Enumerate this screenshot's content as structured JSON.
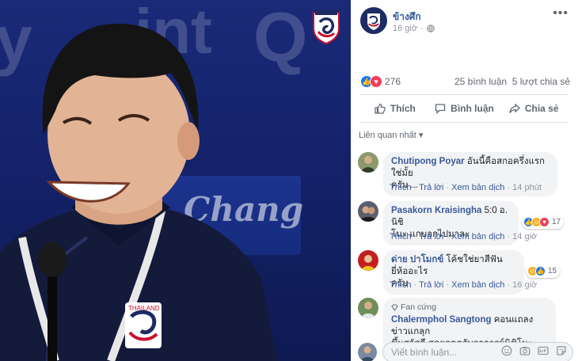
{
  "photo": {
    "bg_words": [
      "y",
      "int",
      "Q"
    ],
    "board_text": "Chang",
    "jersey_text": "THAILAND"
  },
  "post": {
    "page_name": "ข้างศึก",
    "time": "16 giờ",
    "reactions_count": "276",
    "comments_count": "25 bình luận",
    "shares_count": "5 lượt chia sẻ",
    "actions": {
      "like": "Thích",
      "comment": "Bình luận",
      "share": "Chia sẻ"
    },
    "sort_label": "Liên quan nhất"
  },
  "comments": [
    {
      "author": "Chutipong Poyar",
      "text_line1": "อันนี้คือสกอครึ่งแรกใช่มั้ย",
      "text_line2": "ครับ ...",
      "like": "Thích",
      "reply": "Trả lời",
      "translate": "Xem bản dịch",
      "time": "14 phút"
    },
    {
      "author": "Pasakorn Kraisingha",
      "text_line1": "5:0 อ. นิชิ",
      "text_line2": "โนะ แกบอกไปมาละ",
      "like": "Thích",
      "reply": "Trả lời",
      "translate": "Xem bản dịch",
      "time": "14 giờ",
      "reaction_count": "17"
    },
    {
      "author": "ด่าย ปาโมกข์",
      "text_line1": "โค้ชใช่ยาสีฟันยี่ห้ออะไร",
      "text_line2": "ครับ",
      "like": "Thích",
      "reply": "Trả lời",
      "translate": "Xem bản dịch",
      "time": "16 giờ",
      "reaction_count": "15"
    },
    {
      "badge": "Fan cứng",
      "author": "Chalermphol Sangtong",
      "text_line1": "คอนแถลงข่าวแกลุก",
      "text_line2": "ขึ้นสวัสดี สุดยอดครับอาจารย์นิชิโนะ"
    }
  ],
  "composer": {
    "placeholder": "Viết bình luận..."
  },
  "colors": {
    "link": "#385898",
    "like_blue": "#1877f2",
    "love_red": "#f33e58",
    "haha_yellow": "#f7b125",
    "bubble_bg": "#f2f3f5"
  }
}
